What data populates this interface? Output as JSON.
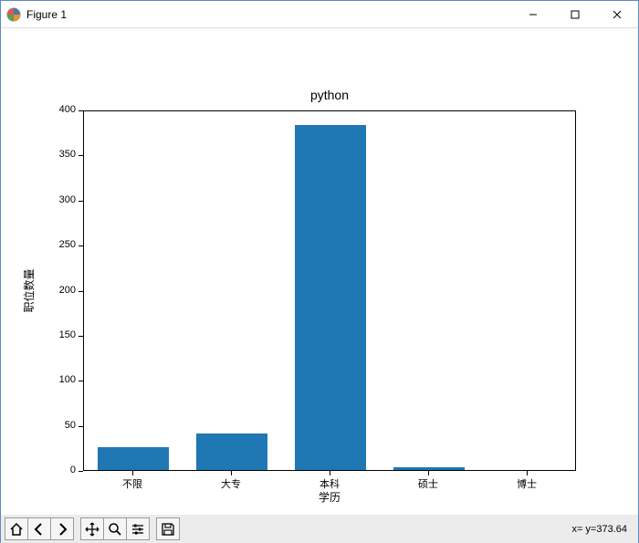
{
  "window": {
    "title": "Figure 1"
  },
  "chart_data": {
    "type": "bar",
    "title": "python",
    "xlabel": "学历",
    "ylabel": "职位数量",
    "categories": [
      "不限",
      "大专",
      "本科",
      "硕士",
      "博士"
    ],
    "values": [
      25,
      41,
      383,
      3,
      0
    ],
    "ylim": [
      0,
      400
    ],
    "yticks": [
      0,
      50,
      100,
      150,
      200,
      250,
      300,
      350,
      400
    ]
  },
  "toolbar": {
    "coords": "x= y=373.64"
  }
}
